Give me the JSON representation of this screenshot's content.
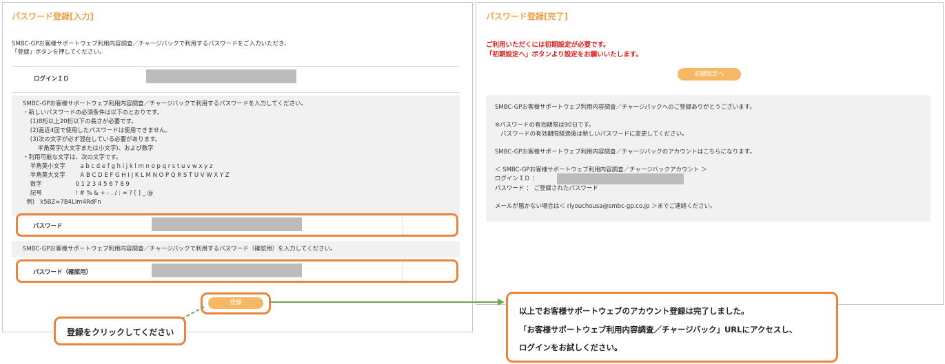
{
  "left": {
    "title": "パスワード登録[入力]",
    "intro_line1": "SMBC-GPお客様サポートウェブ利用内容調査／チャージバックで利用するパスワードをご入力いただき、",
    "intro_line2": "「登録」ボタンを押してください。",
    "login_id_label": "ログインＩＤ",
    "rules": [
      "SMBC-GPお客様サポートウェブ利用内容調査／チャージバックで利用するパスワードを入力してください。",
      "・新しいパスワードの必須条件は以下のとおりです。",
      "    (1)8桁以上20桁以下の長さが必要です。",
      "    (2)直近4回で使用したパスワードは使用できません。",
      "    (3)次の文字が必ず混在している必要があります。",
      "        半角英字(大文字または小文字)、および数字",
      "・利用可能な文字は、次の文字です。",
      "    半角英小文字        a b c d e f g h i j k l m n o p q r s t u v w x y z",
      "    半角英大文字        A B C D E F G H I J K L M N O P Q R S T U V W X Y Z",
      "    数字                  0 1 2 3 4 5 6 7 8 9",
      "    記号                  ! # % & + - . / : = ? [ ] _ @",
      "  例)   k5BZ=7B4LIm4RdFn"
    ],
    "password_label": "パスワード",
    "confirm_instruction": "SMBC-GPお客様サポートウェブ利用内容調査／チャージバックで利用するパスワード（確認用）を入力してください。",
    "confirm_label": "パスワード（確認用）",
    "register_button": "登録"
  },
  "right": {
    "title": "パスワード登録[完了]",
    "warning_line1": "ご利用いただくには初期設定が必要です。",
    "warning_line2": "「初期設定へ」ボタンより設定をお願いいたします。",
    "init_button": "初期設定へ",
    "info_lines": [
      "SMBC-GPお客様サポートウェブ利用内容調査／チャージバックへのご登録ありがとうございます。",
      "",
      "※パスワードの有効期限は90日です。",
      "   パスワードの有効期限経過後は新しいパスワードに変更してください。",
      "",
      "SMBC-GPお客様サポートウェブ利用内容調査／チャージバックのアカウントはこちらになります。",
      "",
      "＜ SMBC-GPお客様サポートウェブ利用内容調査／チャージバックアカウント ＞"
    ],
    "login_id_label": "ログインＩＤ ：",
    "password_line": "パスワード ： ご登録されたパスワード",
    "contact_line": "メールが届かない場合は＜ riyouchousa@smbc-gp.co.jp ＞までご連絡ください。"
  },
  "callouts": {
    "click_register": "登録をクリックしてください",
    "complete_line1": "以上でお客様サポートウェブのアカウント登録は完了しました。",
    "complete_line2": "「お客様サポートウェブ利用内容調査／チャージバック」URLにアクセスし、",
    "complete_line3": "ログインをお試しください。"
  },
  "colors": {
    "accent": "#f0a24a",
    "highlight": "#e9843a",
    "warning": "#e02020",
    "connector": "#6aa84f"
  }
}
